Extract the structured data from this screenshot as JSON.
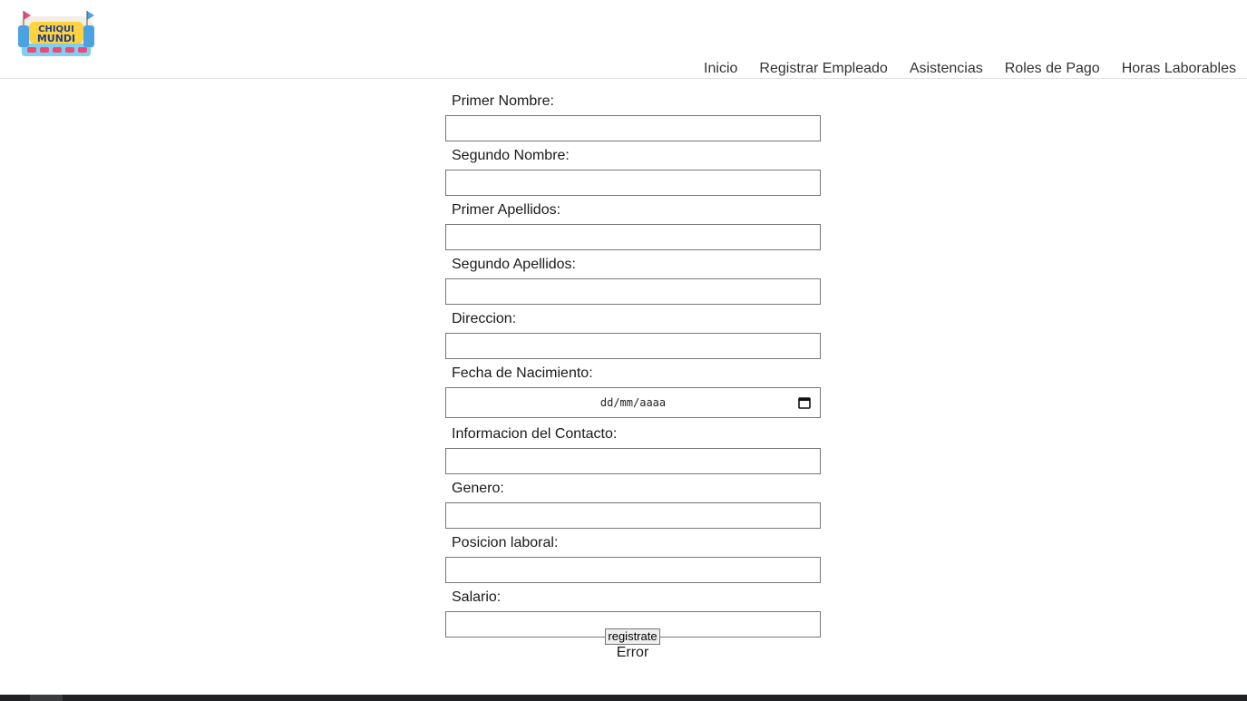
{
  "brand": {
    "logo_text_top": "CHIQUI",
    "logo_text_bottom": "MUNDI"
  },
  "nav": {
    "items": [
      {
        "label": "Inicio"
      },
      {
        "label": "Registrar Empleado"
      },
      {
        "label": "Asistencias"
      },
      {
        "label": "Roles de Pago"
      },
      {
        "label": "Horas Laborables"
      }
    ]
  },
  "form": {
    "fields": [
      {
        "label": "Primer Nombre:",
        "value": ""
      },
      {
        "label": "Segundo Nombre:",
        "value": ""
      },
      {
        "label": "Primer Apellidos:",
        "value": ""
      },
      {
        "label": "Segundo Apellidos:",
        "value": ""
      },
      {
        "label": "Direccion:",
        "value": ""
      },
      {
        "label": "Fecha de Nacimiento:",
        "placeholder": "dd/mm/aaaa"
      },
      {
        "label": "Informacion del Contacto:",
        "value": ""
      },
      {
        "label": "Genero:",
        "value": ""
      },
      {
        "label": "Posicion laboral:",
        "value": ""
      },
      {
        "label": "Salario:",
        "value": ""
      }
    ],
    "submit_label": "registrate",
    "status_text": "Error"
  },
  "icons": {
    "logo": "chiqui-mundi-logo",
    "calendar": "calendar-icon"
  }
}
